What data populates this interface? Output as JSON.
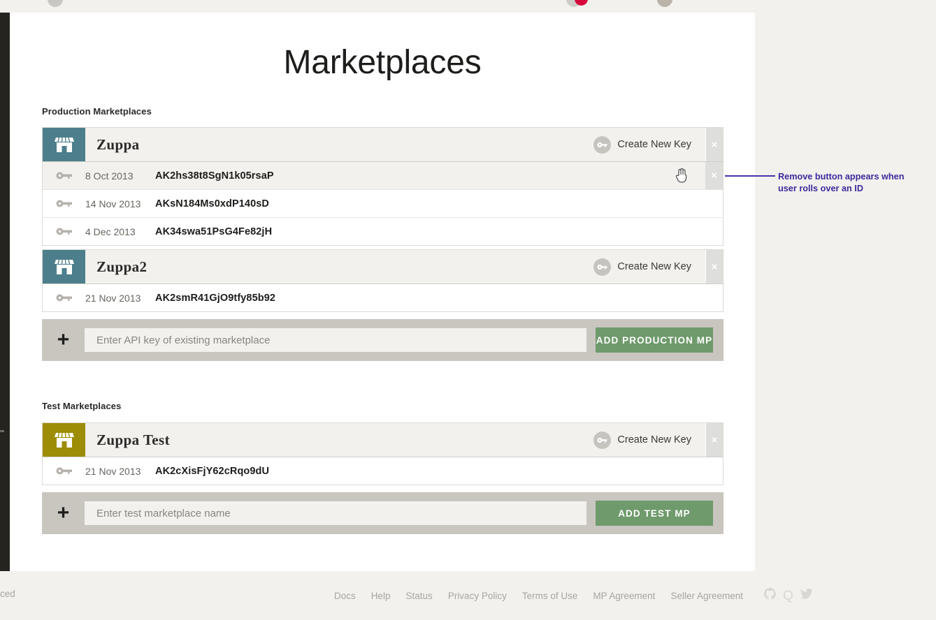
{
  "page": {
    "title": "Marketplaces"
  },
  "sections": {
    "production": {
      "label": "Production Marketplaces",
      "marketplaces": [
        {
          "name": "Zuppa",
          "icon": "storefront-icon",
          "create_key_label": "Create New Key",
          "remove_label": "×",
          "keys": [
            {
              "date": "8 Oct 2013",
              "id": "AK2hs38t8SgN1k05rsaP",
              "hovered": true
            },
            {
              "date": "14 Nov 2013",
              "id": "AKsN184Ms0xdP140sD",
              "hovered": false
            },
            {
              "date": "4 Dec 2013",
              "id": "AK34swa51PsG4Fe82jH",
              "hovered": false
            }
          ]
        },
        {
          "name": "Zuppa2",
          "icon": "storefront-icon",
          "create_key_label": "Create New Key",
          "remove_label": "×",
          "keys": [
            {
              "date": "21 Nov 2013",
              "id": "AK2smR41GjO9tfy85b92",
              "hovered": false
            }
          ]
        }
      ],
      "add": {
        "plus_label": "+",
        "placeholder": "Enter API key of existing marketplace",
        "value": "",
        "button_label": "ADD PRODUCTION MP"
      }
    },
    "test": {
      "label": "Test Marketplaces",
      "marketplaces": [
        {
          "name": "Zuppa Test",
          "icon": "storefront-icon",
          "create_key_label": "Create New Key",
          "remove_label": "×",
          "keys": [
            {
              "date": "21 Nov 2013",
              "id": "AK2cXisFjY62cRqo9dU",
              "hovered": false
            }
          ]
        }
      ],
      "add": {
        "plus_label": "+",
        "placeholder": "Enter test marketplace name",
        "value": "",
        "button_label": "ADD TEST MP"
      }
    }
  },
  "annotation": {
    "line1": "Remove button appears when",
    "line2": "user rolls over an ID"
  },
  "footer": {
    "left_text": "ced",
    "links": [
      "Docs",
      "Help",
      "Status",
      "Privacy Policy",
      "Terms of Use",
      "MP Agreement",
      "Seller Agreement"
    ],
    "social": [
      "github-icon",
      "q-icon",
      "twitter-icon"
    ],
    "q_label": "Q"
  },
  "colors": {
    "production_accent": "#4c7f8b",
    "test_accent": "#9c8c06",
    "submit_green": "#6f9a6c",
    "annotation_purple": "#3f2a9c",
    "badge_red": "#d6083b"
  }
}
